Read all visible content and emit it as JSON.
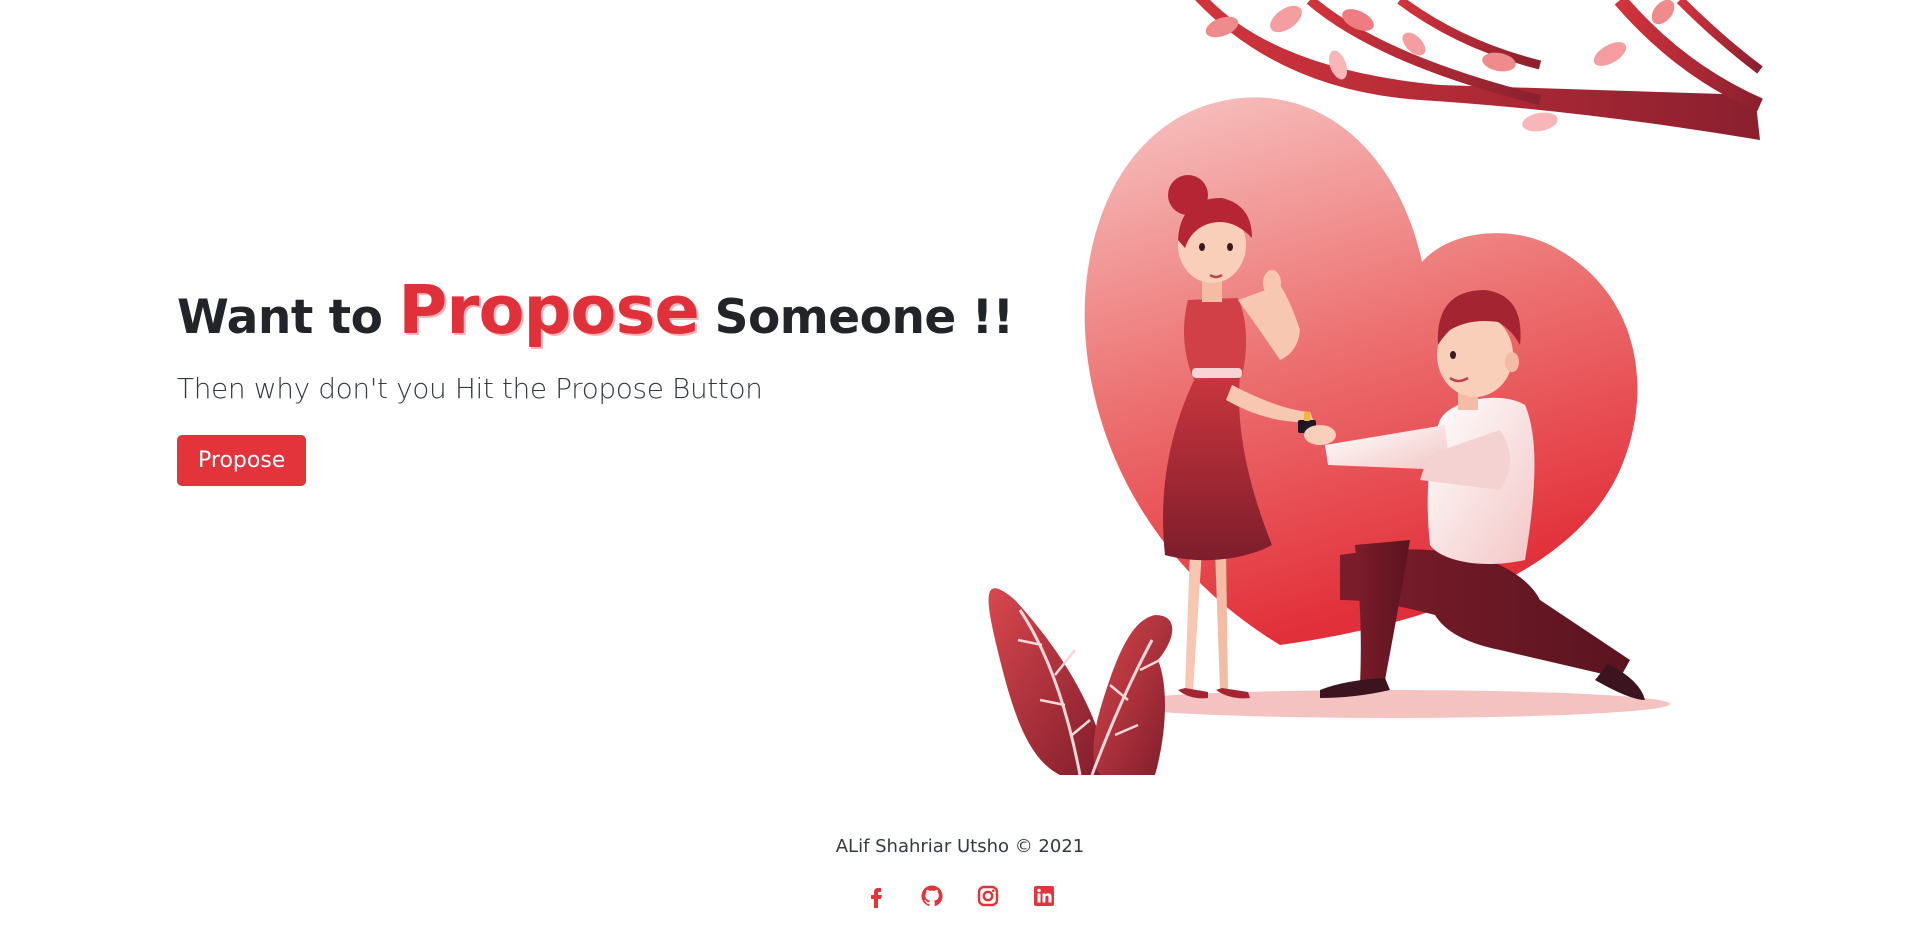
{
  "hero": {
    "headline_before": "Want to ",
    "headline_accent": "Propose",
    "headline_after": " Someone !!",
    "subtitle": "Then why don't you Hit the Propose Button",
    "button_label": "Propose"
  },
  "footer": {
    "credit": "ALif Shahriar Utsho © 2021",
    "socials": [
      {
        "icon": "facebook-icon"
      },
      {
        "icon": "github-icon"
      },
      {
        "icon": "instagram-icon"
      },
      {
        "icon": "linkedin-icon"
      }
    ]
  },
  "colors": {
    "accent": "#e3343b",
    "text": "#212529"
  }
}
